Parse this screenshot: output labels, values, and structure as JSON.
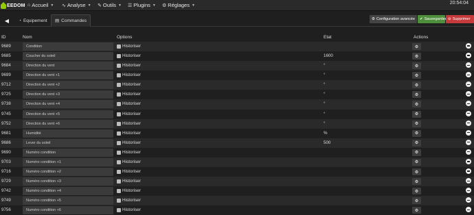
{
  "navbar": {
    "logo_text": "EEDOM",
    "items": [
      {
        "label": "Accueil",
        "icon": "home-icon"
      },
      {
        "label": "Analyse",
        "icon": "wave-icon"
      },
      {
        "label": "Outils",
        "icon": "wrench-icon"
      },
      {
        "label": "Plugins",
        "icon": "tasks-icon"
      },
      {
        "label": "Réglages",
        "icon": "cogs-icon"
      }
    ],
    "clock": "20:54:04"
  },
  "tabs": {
    "items": [
      {
        "label": "Equipement",
        "icon": "tachometer-icon"
      },
      {
        "label": "Commandes",
        "icon": "list-alt-icon"
      }
    ],
    "active": "Commandes"
  },
  "buttons": {
    "advanced_config": "Configuration avancée",
    "save": "Sauvegarder",
    "delete": "Supprimer"
  },
  "colors": {
    "accent": "#94ca02",
    "save": "#4d8f3a",
    "delete": "#c53b3b"
  },
  "table": {
    "headers": {
      "id": "ID",
      "name": "Nom",
      "options": "Options",
      "state": "Etat",
      "actions": "Actions"
    },
    "option_label": "Historiser",
    "rows": [
      {
        "id": "9689",
        "name": "Condition",
        "state": ""
      },
      {
        "id": "9685",
        "name": "Coucher du soleil",
        "state": "1600"
      },
      {
        "id": "9684",
        "name": "Direction du vent",
        "state": "°"
      },
      {
        "id": "9699",
        "name": "Direction du vent +1",
        "state": "°"
      },
      {
        "id": "9712",
        "name": "Direction du vent +2",
        "state": "°"
      },
      {
        "id": "9725",
        "name": "Direction du vent +3",
        "state": "°"
      },
      {
        "id": "9738",
        "name": "Direction du vent +4",
        "state": "°"
      },
      {
        "id": "9745",
        "name": "Direction du vent +5",
        "state": "°"
      },
      {
        "id": "9752",
        "name": "Direction du vent +6",
        "state": "°"
      },
      {
        "id": "9681",
        "name": "Humidité",
        "state": "%"
      },
      {
        "id": "9686",
        "name": "Lever du soleil",
        "state": "500"
      },
      {
        "id": "9690",
        "name": "Numéro condition",
        "state": ""
      },
      {
        "id": "9703",
        "name": "Numéro condition +1",
        "state": ""
      },
      {
        "id": "9716",
        "name": "Numéro condition +2",
        "state": ""
      },
      {
        "id": "9729",
        "name": "Numéro condition +3",
        "state": ""
      },
      {
        "id": "9742",
        "name": "Numéro condition +4",
        "state": ""
      },
      {
        "id": "9749",
        "name": "Numéro condition +5",
        "state": ""
      },
      {
        "id": "9756",
        "name": "Numéro condition +6",
        "state": ""
      }
    ]
  }
}
